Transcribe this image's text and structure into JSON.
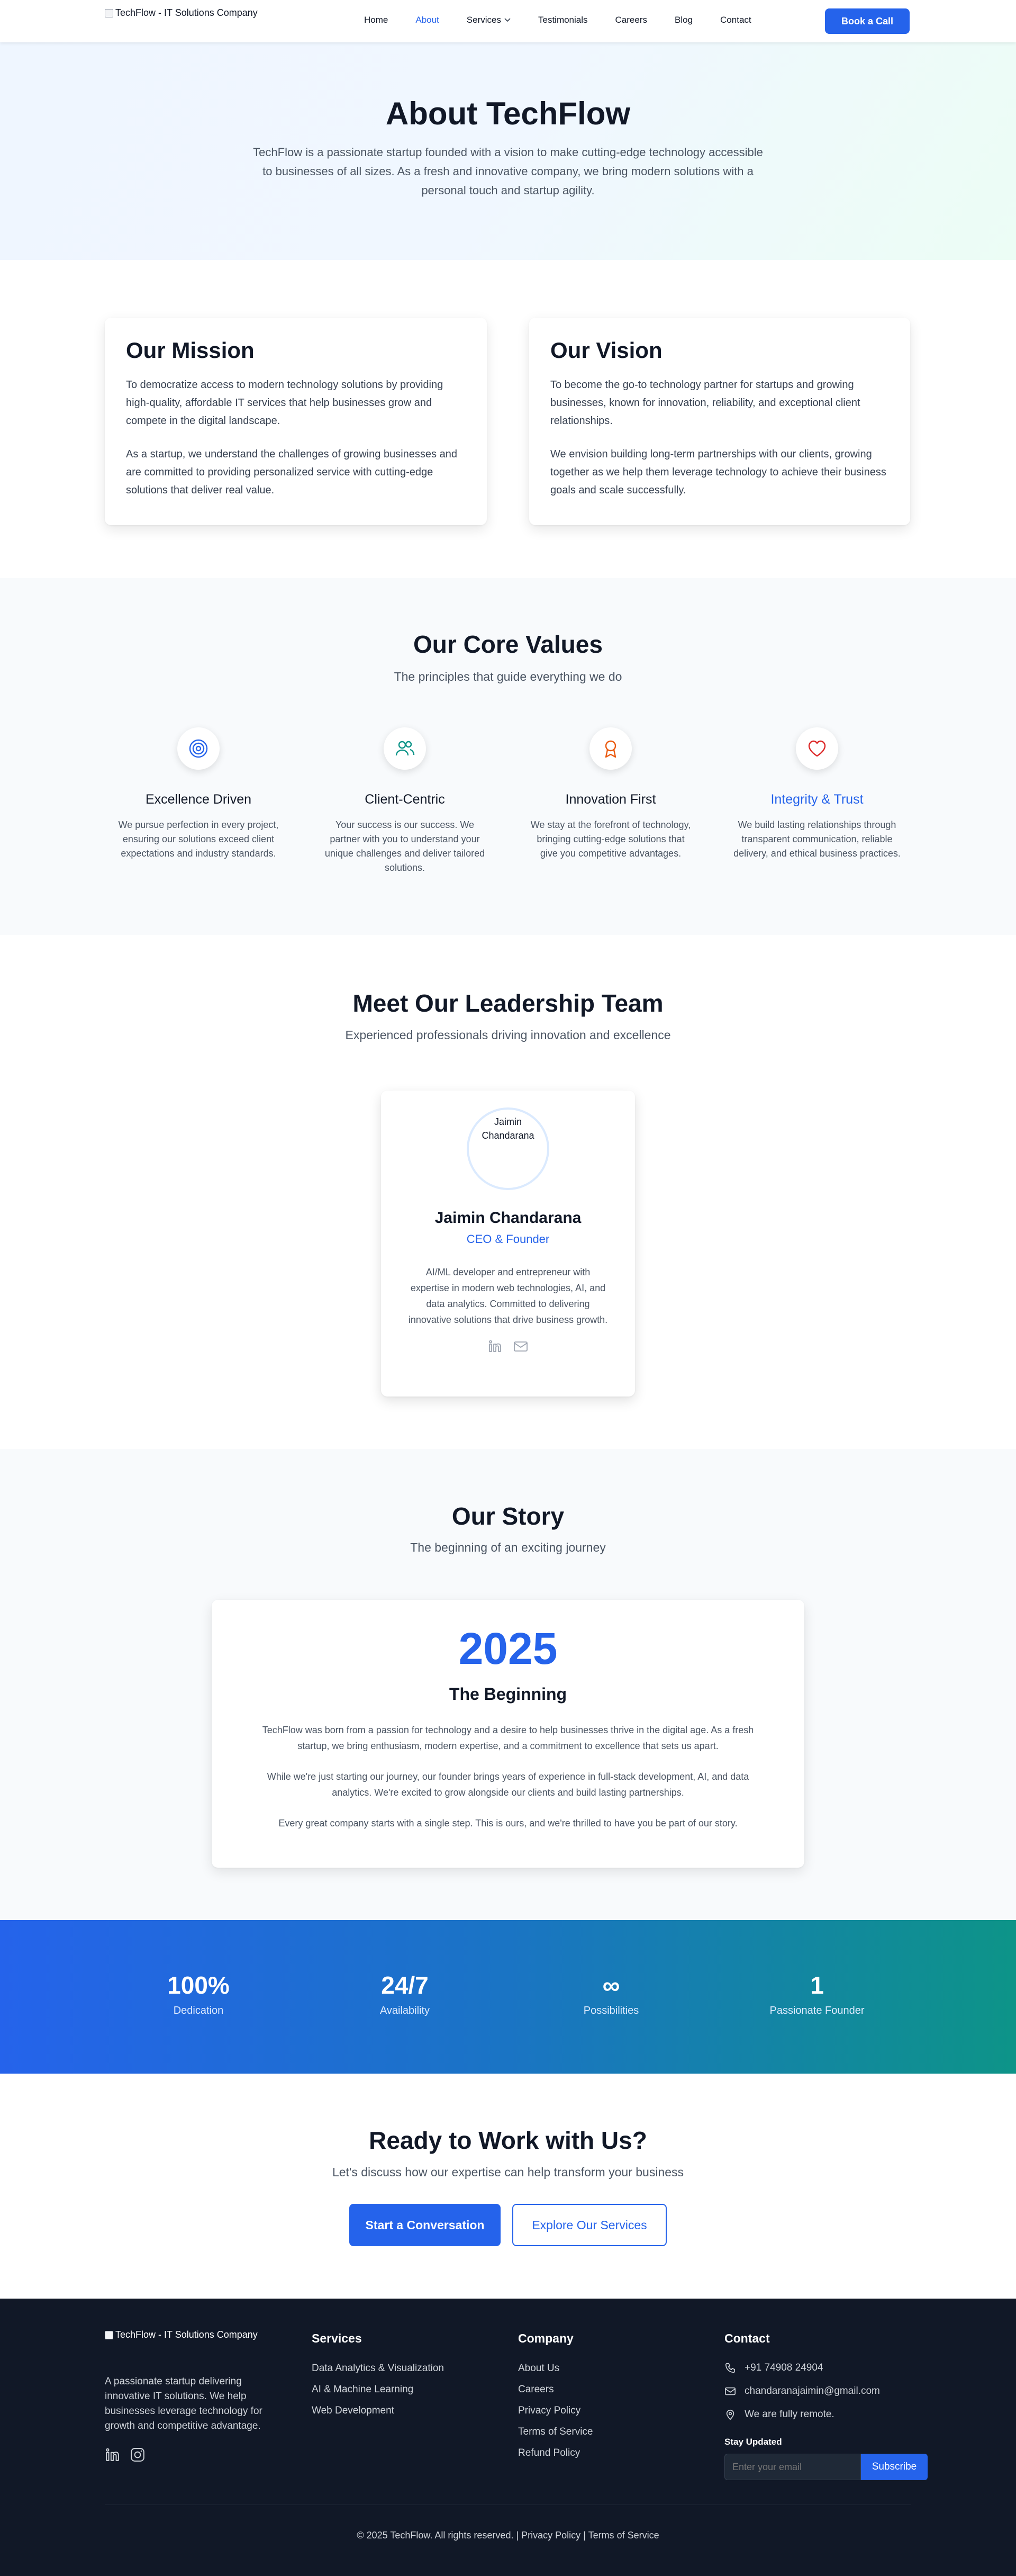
{
  "header": {
    "logo_alt": "TechFlow - IT Solutions Company",
    "nav": [
      {
        "label": "Home"
      },
      {
        "label": "About",
        "active": true
      },
      {
        "label": "Services"
      },
      {
        "label": "Testimonials"
      },
      {
        "label": "Careers"
      },
      {
        "label": "Blog"
      },
      {
        "label": "Contact"
      }
    ],
    "cta": "Book a Call"
  },
  "hero": {
    "title": "About TechFlow",
    "text": "TechFlow is a passionate startup founded with a vision to make cutting-edge technology accessible to businesses of all sizes. As a fresh and innovative company, we bring modern solutions with a personal touch and startup agility."
  },
  "mission": {
    "title": "Our Mission",
    "p1": "To democratize access to modern technology solutions by providing high-quality, affordable IT services that help businesses grow and compete in the digital landscape.",
    "p2": "As a startup, we understand the challenges of growing businesses and are committed to providing personalized service with cutting-edge solutions that deliver real value."
  },
  "vision": {
    "title": "Our Vision",
    "p1": "To become the go-to technology partner for startups and growing businesses, known for innovation, reliability, and exceptional client relationships.",
    "p2": "We envision building long-term partnerships with our clients, growing together as we help them leverage technology to achieve their business goals and scale successfully."
  },
  "values": {
    "title": "Our Core Values",
    "subtitle": "The principles that guide everything we do",
    "items": [
      {
        "icon": "target-icon",
        "color": "#2563eb",
        "title": "Excellence Driven",
        "text": "We pursue perfection in every project, ensuring our solutions exceed client expectations and industry standards."
      },
      {
        "icon": "users-icon",
        "color": "#0d9488",
        "title": "Client-Centric",
        "text": "Your success is our success. We partner with you to understand your unique challenges and deliver tailored solutions."
      },
      {
        "icon": "award-icon",
        "color": "#ea580c",
        "title": "Innovation First",
        "text": "We stay at the forefront of technology, bringing cutting-edge solutions that give you competitive advantages."
      },
      {
        "icon": "heart-icon",
        "color": "#dc2626",
        "title": "Integrity & Trust",
        "text": "We build lasting relationships through transparent communication, reliable delivery, and ethical business practices.",
        "highlight": true
      }
    ]
  },
  "team": {
    "title": "Meet Our Leadership Team",
    "subtitle": "Experienced professionals driving innovation and excellence",
    "member": {
      "photo_alt": "Jaimin Chandarana",
      "name": "Jaimin Chandarana",
      "role": "CEO & Founder",
      "bio": "AI/ML developer and entrepreneur with expertise in modern web technologies, AI, and data analytics. Committed to delivering innovative solutions that drive business growth.",
      "icons": [
        "linkedin-icon",
        "mail-icon"
      ]
    }
  },
  "story": {
    "title": "Our Story",
    "subtitle": "The beginning of an exciting journey",
    "year": "2025",
    "heading": "The Beginning",
    "p1": "TechFlow was born from a passion for technology and a desire to help businesses thrive in the digital age. As a fresh startup, we bring enthusiasm, modern expertise, and a commitment to excellence that sets us apart.",
    "p2": "While we're just starting our journey, our founder brings years of experience in full-stack development, AI, and data analytics. We're excited to grow alongside our clients and build lasting partnerships.",
    "p3": "Every great company starts with a single step. This is ours, and we're thrilled to have you be part of our story."
  },
  "stats": [
    {
      "value": "100%",
      "label": "Dedication"
    },
    {
      "value": "24/7",
      "label": "Availability"
    },
    {
      "value": "∞",
      "label": "Possibilities"
    },
    {
      "value": "1",
      "label": "Passionate Founder"
    }
  ],
  "cta": {
    "title": "Ready to Work with Us?",
    "subtitle": "Let's discuss how our expertise can help transform your business",
    "primary": "Start a Conversation",
    "secondary": "Explore Our Services"
  },
  "footer": {
    "logo_alt": "TechFlow - IT Solutions Company",
    "about": "A passionate startup delivering innovative IT solutions. We help businesses leverage technology for growth and competitive advantage.",
    "services_title": "Services",
    "services": [
      "Data Analytics & Visualization",
      "AI & Machine Learning",
      "Web Development"
    ],
    "company_title": "Company",
    "company": [
      "About Us",
      "Careers",
      "Privacy Policy",
      "Terms of Service",
      "Refund Policy"
    ],
    "contact_title": "Contact",
    "phone": "+91 74908 24904",
    "email": "chandaranajaimin@gmail.com",
    "location": "We are fully remote.",
    "newsletter_title": "Stay Updated",
    "newsletter_placeholder": "Enter your email",
    "subscribe": "Subscribe",
    "copyright": "© 2025 TechFlow. All rights reserved.",
    "privacy": "Privacy Policy",
    "terms": "Terms of Service"
  },
  "colors": {
    "accent": "#2563eb",
    "teal": "#0d9488",
    "footer_bg": "#111827"
  }
}
